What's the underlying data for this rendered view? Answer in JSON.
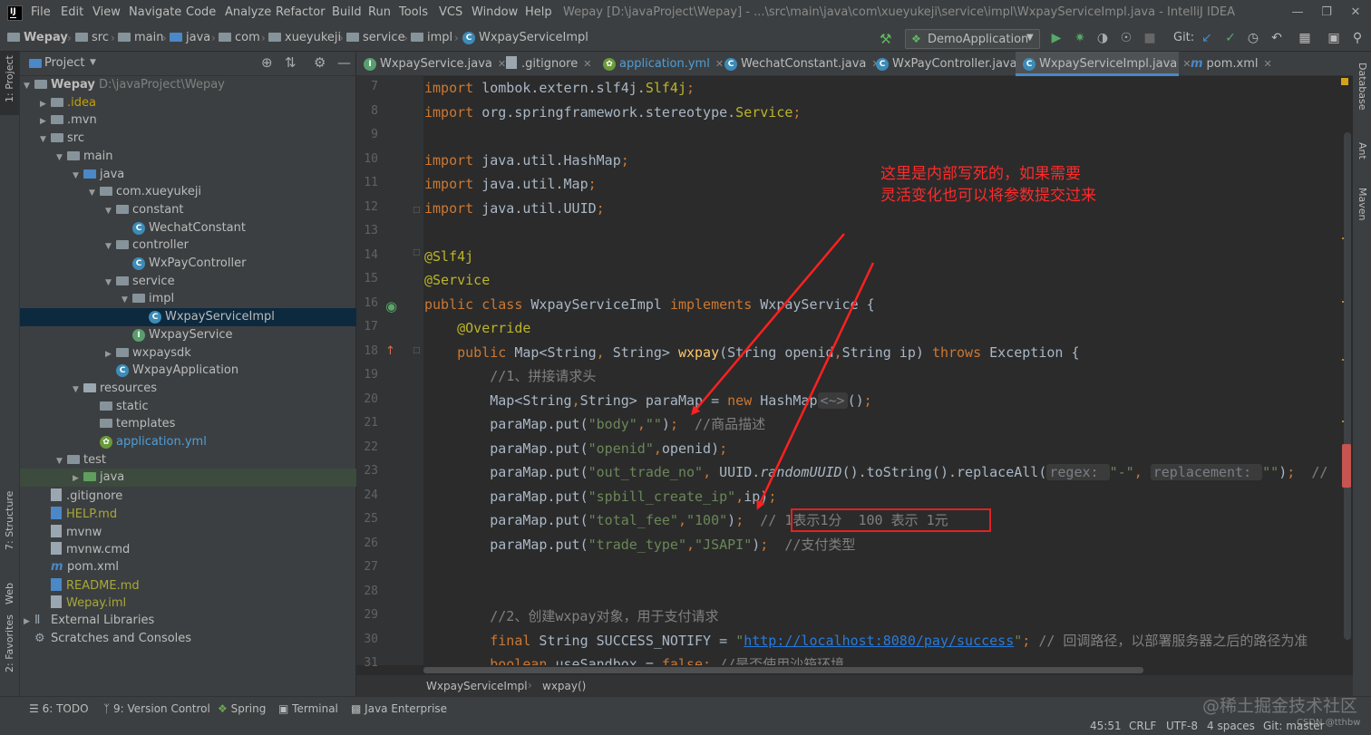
{
  "menubar": {
    "items": [
      "File",
      "Edit",
      "View",
      "Navigate",
      "Code",
      "Analyze",
      "Refactor",
      "Build",
      "Run",
      "Tools",
      "VCS",
      "Window",
      "Help"
    ],
    "title": "Wepay [D:\\javaProject\\Wepay] - ...\\src\\main\\java\\com\\xueyukeji\\service\\impl\\WxpayServiceImpl.java - IntelliJ IDEA"
  },
  "breadcrumbs": [
    "Wepay",
    "src",
    "main",
    "java",
    "com",
    "xueyukeji",
    "service",
    "impl",
    "WxpayServiceImpl"
  ],
  "toolbar": {
    "run_config": "DemoApplication",
    "git_label": "Git:"
  },
  "left_tools": [
    "1: Project",
    "7: Structure",
    "Web",
    "2: Favorites"
  ],
  "right_tools": [
    "Database",
    "Ant",
    "Maven"
  ],
  "project": {
    "title": "Project",
    "tree": [
      {
        "label": "Wepay",
        "extra": "D:\\javaProject\\Wepay",
        "depth": 0,
        "arrow": "open",
        "icon": "folder",
        "color": "#bbbbbb",
        "bold": true
      },
      {
        "label": ".idea",
        "depth": 1,
        "arrow": "closed",
        "icon": "folder",
        "color": "#c4a000"
      },
      {
        "label": ".mvn",
        "depth": 1,
        "arrow": "closed",
        "icon": "folder",
        "color": "#bbbbbb"
      },
      {
        "label": "src",
        "depth": 1,
        "arrow": "open",
        "icon": "folder",
        "color": "#bbbbbb"
      },
      {
        "label": "main",
        "depth": 2,
        "arrow": "open",
        "icon": "folder",
        "color": "#bbbbbb"
      },
      {
        "label": "java",
        "depth": 3,
        "arrow": "open",
        "icon": "folder-blue",
        "color": "#bbbbbb"
      },
      {
        "label": "com.xueyukeji",
        "depth": 4,
        "arrow": "open",
        "icon": "folder",
        "color": "#bbbbbb"
      },
      {
        "label": "constant",
        "depth": 5,
        "arrow": "open",
        "icon": "folder",
        "color": "#bbbbbb"
      },
      {
        "label": "WechatConstant",
        "depth": 6,
        "arrow": "none",
        "icon": "class",
        "color": "#bbbbbb"
      },
      {
        "label": "controller",
        "depth": 5,
        "arrow": "open",
        "icon": "folder",
        "color": "#bbbbbb"
      },
      {
        "label": "WxPayController",
        "depth": 6,
        "arrow": "none",
        "icon": "class",
        "color": "#bbbbbb"
      },
      {
        "label": "service",
        "depth": 5,
        "arrow": "open",
        "icon": "folder",
        "color": "#bbbbbb"
      },
      {
        "label": "impl",
        "depth": 6,
        "arrow": "open",
        "icon": "folder",
        "color": "#bbbbbb"
      },
      {
        "label": "WxpayServiceImpl",
        "depth": 7,
        "arrow": "none",
        "icon": "class",
        "color": "#bbbbbb",
        "selected": true
      },
      {
        "label": "WxpayService",
        "depth": 6,
        "arrow": "none",
        "icon": "interface",
        "color": "#bbbbbb"
      },
      {
        "label": "wxpaysdk",
        "depth": 5,
        "arrow": "closed",
        "icon": "folder",
        "color": "#bbbbbb"
      },
      {
        "label": "WxpayApplication",
        "depth": 5,
        "arrow": "none",
        "icon": "class-run",
        "color": "#bbbbbb"
      },
      {
        "label": "resources",
        "depth": 3,
        "arrow": "open",
        "icon": "folder-res",
        "color": "#bbbbbb"
      },
      {
        "label": "static",
        "depth": 4,
        "arrow": "none",
        "icon": "folder",
        "color": "#bbbbbb"
      },
      {
        "label": "templates",
        "depth": 4,
        "arrow": "none",
        "icon": "folder",
        "color": "#bbbbbb"
      },
      {
        "label": "application.yml",
        "depth": 4,
        "arrow": "none",
        "icon": "yml",
        "color": "#4e9ed8"
      },
      {
        "label": "test",
        "depth": 2,
        "arrow": "open",
        "icon": "folder",
        "color": "#bbbbbb"
      },
      {
        "label": "java",
        "depth": 3,
        "arrow": "closed",
        "icon": "folder-green",
        "color": "#bbbbbb",
        "highlight": true
      },
      {
        "label": ".gitignore",
        "depth": 1,
        "arrow": "none",
        "icon": "file",
        "color": "#bbbbbb"
      },
      {
        "label": "HELP.md",
        "depth": 1,
        "arrow": "none",
        "icon": "md",
        "color": "#a8a838"
      },
      {
        "label": "mvnw",
        "depth": 1,
        "arrow": "none",
        "icon": "file",
        "color": "#bbbbbb"
      },
      {
        "label": "mvnw.cmd",
        "depth": 1,
        "arrow": "none",
        "icon": "file",
        "color": "#bbbbbb"
      },
      {
        "label": "pom.xml",
        "depth": 1,
        "arrow": "none",
        "icon": "maven",
        "color": "#bbbbbb"
      },
      {
        "label": "README.md",
        "depth": 1,
        "arrow": "none",
        "icon": "md",
        "color": "#a8a838"
      },
      {
        "label": "Wepay.iml",
        "depth": 1,
        "arrow": "none",
        "icon": "file",
        "color": "#a8a838"
      },
      {
        "label": "External Libraries",
        "depth": 0,
        "arrow": "closed",
        "icon": "lib",
        "color": "#bbbbbb"
      },
      {
        "label": "Scratches and Consoles",
        "depth": 0,
        "arrow": "none",
        "icon": "scratch",
        "color": "#bbbbbb"
      }
    ]
  },
  "tabs": [
    {
      "label": "WxpayService.java",
      "icon": "I",
      "active": false,
      "color": "#bbbbbb"
    },
    {
      "label": ".gitignore",
      "icon": "g",
      "active": false,
      "color": "#bbbbbb"
    },
    {
      "label": "application.yml",
      "icon": "y",
      "active": false,
      "color": "#4e9ed8"
    },
    {
      "label": "WechatConstant.java",
      "icon": "C",
      "active": false,
      "color": "#bbbbbb"
    },
    {
      "label": "WxPayController.java",
      "icon": "C",
      "active": false,
      "color": "#bbbbbb"
    },
    {
      "label": "WxpayServiceImpl.java",
      "icon": "C",
      "active": true,
      "color": "#bbbbbb"
    },
    {
      "label": "pom.xml",
      "icon": "m",
      "active": false,
      "color": "#bbbbbb"
    }
  ],
  "editor": {
    "lines": [
      {
        "n": "7",
        "html": "<span class=\"kw\">import</span> lombok.extern.slf4j.<span class=\"an\">Slf4j</span><span class=\"kw\">;</span>"
      },
      {
        "n": "8",
        "html": "<span class=\"kw\">import</span> org.springframework.stereotype.<span class=\"an\">Service</span><span class=\"kw\">;</span>"
      },
      {
        "n": "9",
        "html": ""
      },
      {
        "n": "10",
        "html": "<span class=\"kw\">import</span> java.util.HashMap<span class=\"kw\">;</span>"
      },
      {
        "n": "11",
        "html": "<span class=\"kw\">import</span> java.util.Map<span class=\"kw\">;</span>"
      },
      {
        "n": "12",
        "html": "<span class=\"kw\">import</span> java.util.UUID<span class=\"kw\">;</span>"
      },
      {
        "n": "13",
        "html": ""
      },
      {
        "n": "14",
        "html": "<span class=\"an\">@Slf4j</span>"
      },
      {
        "n": "15",
        "html": "<span class=\"an\">@Service</span>"
      },
      {
        "n": "16",
        "html": "<span class=\"kw\">public class</span> WxpayServiceImpl <span class=\"kw\">implements</span> WxpayService {"
      },
      {
        "n": "17",
        "html": "    <span class=\"an\">@Override</span>"
      },
      {
        "n": "18",
        "html": "    <span class=\"kw\">public</span> Map&lt;String<span class=\"kw\">,</span> String&gt; <span class=\"fn\">wxpay</span>(String openid<span class=\"kw\">,</span>String ip) <span class=\"kw\">throws</span> Exception {"
      },
      {
        "n": "19",
        "html": "        <span class=\"cm\">//1、拼接请求头</span>"
      },
      {
        "n": "20",
        "html": "        Map&lt;String<span class=\"kw\">,</span>String&gt; paraMap = <span class=\"kw\">new</span> HashMap<span class=\"hint\">&lt;~&gt;</span>()<span class=\"kw\">;</span>"
      },
      {
        "n": "21",
        "html": "        paraMap.put(<span class=\"st\">\"body\"</span><span class=\"kw\">,</span><span class=\"st\">\"\"</span>)<span class=\"kw\">;</span>  <span class=\"cm\">//商品描述</span>"
      },
      {
        "n": "22",
        "html": "        paraMap.put(<span class=\"st\">\"openid\"</span><span class=\"kw\">,</span>openid)<span class=\"kw\">;</span>"
      },
      {
        "n": "23",
        "html": "        paraMap.put(<span class=\"st\">\"out_trade_no\"</span><span class=\"kw\">,</span> UUID.<span class=\"it\">randomUUID</span>().toString().replaceAll(<span class=\"hint\">regex: </span><span class=\"st\">\"-\"</span><span class=\"kw\">,</span> <span class=\"hint\">replacement: </span><span class=\"st\">\"\"</span>)<span class=\"kw\">;</span>  <span class=\"cm\">//</span>"
      },
      {
        "n": "24",
        "html": "        paraMap.put(<span class=\"st\">\"spbill_create_ip\"</span><span class=\"kw\">,</span>ip)<span class=\"kw\">;</span>"
      },
      {
        "n": "25",
        "html": "        paraMap.put(<span class=\"st\">\"total_fee\"</span><span class=\"kw\">,</span><span class=\"st\">\"100\"</span>)<span class=\"kw\">;</span>  <span class=\"cm\">// 1表示1分  100 表示 1元</span>"
      },
      {
        "n": "26",
        "html": "        paraMap.put(<span class=\"st\">\"trade_type\"</span><span class=\"kw\">,</span><span class=\"st\">\"JSAPI\"</span>)<span class=\"kw\">;</span>  <span class=\"cm\">//支付类型</span>"
      },
      {
        "n": "27",
        "html": ""
      },
      {
        "n": "28",
        "html": ""
      },
      {
        "n": "29",
        "html": "        <span class=\"cm\">//2、创建wxpay对象，用于支付请求</span>"
      },
      {
        "n": "30",
        "html": "        <span class=\"kw\">final</span> String SUCCESS_NOTIFY = <span class=\"st\">\"<span class=\"url\">http://localhost:8080/pay/success</span>\"</span><span class=\"kw\">;</span> <span class=\"cm\">// 回调路径，以部署服务器之后的路径为准</span>"
      },
      {
        "n": "31",
        "html": "        <span class=\"kw\">boolean</span> useSandbox = <span class=\"kw\">false;</span> <span class=\"cm\">//是否使用沙箱环境</span>"
      }
    ]
  },
  "editor_breadcrumb": [
    "WxpayServiceImpl",
    "wxpay()"
  ],
  "annotation": {
    "line1": "这里是内部写死的，如果需要",
    "line2": "灵活变化也可以将参数提交过来"
  },
  "bottom_tools": [
    "6: TODO",
    "9: Version Control",
    "Spring",
    "Terminal",
    "Java Enterprise"
  ],
  "status": {
    "position": "45:51",
    "line_sep": "CRLF",
    "encoding": "UTF-8",
    "indent": "4 spaces",
    "git": "Git: master"
  },
  "watermark": {
    "main": "@稀土掘金技术社区",
    "small": "CSDN @tthbw"
  },
  "colors": {
    "accent": "#4a88c7",
    "annotation_red": "#ff2b2b",
    "selection": "#0d293e"
  }
}
